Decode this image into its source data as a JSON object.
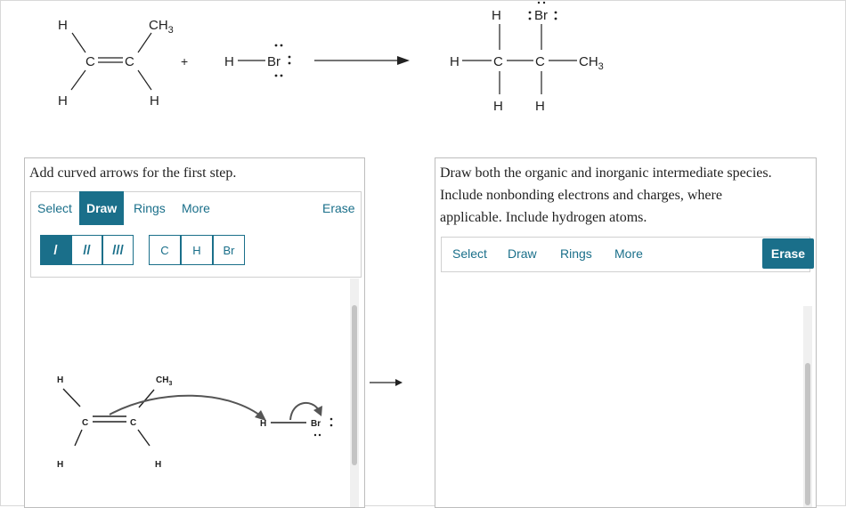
{
  "scheme": {
    "reactant1": {
      "h_top_left": "H",
      "ch3_top": "CH",
      "ch3_sub": "3",
      "c1": "C",
      "c2": "C",
      "h_bottom_left": "H",
      "h_bottom_right": "H"
    },
    "plus": "+",
    "reactant2": {
      "h": "H",
      "br": "Br"
    },
    "product": {
      "h_top1": "H",
      "br_top": "Br",
      "h_left": "H",
      "c1": "C",
      "c2": "C",
      "ch3": "CH",
      "ch3_sub": "3",
      "h_bottom1": "H",
      "h_bottom2": "H"
    }
  },
  "left_panel": {
    "instruction": "Add curved arrows for the first step.",
    "toolbar": {
      "select": "Select",
      "draw": "Draw",
      "rings": "Rings",
      "more": "More",
      "erase": "Erase"
    },
    "bond_buttons": [
      "/",
      "//",
      "///"
    ],
    "atom_buttons": [
      "C",
      "H",
      "Br"
    ],
    "canvas": {
      "h_top_left": "H",
      "ch3": "CH",
      "ch3_sub": "3",
      "c1": "C",
      "c2": "C",
      "h_bottom_left": "H",
      "h_bottom_right": "H",
      "hbr_h": "H",
      "hbr_br": "Br"
    }
  },
  "right_panel": {
    "instruction_line1": "Draw both the organic and inorganic intermediate species.",
    "instruction_line2": "Include nonbonding electrons and charges, where",
    "instruction_line3": "applicable. Include hydrogen atoms.",
    "toolbar": {
      "select": "Select",
      "draw": "Draw",
      "rings": "Rings",
      "more": "More",
      "erase": "Erase"
    }
  },
  "colors": {
    "accent": "#1a6f8a",
    "arrow": "#555555"
  }
}
